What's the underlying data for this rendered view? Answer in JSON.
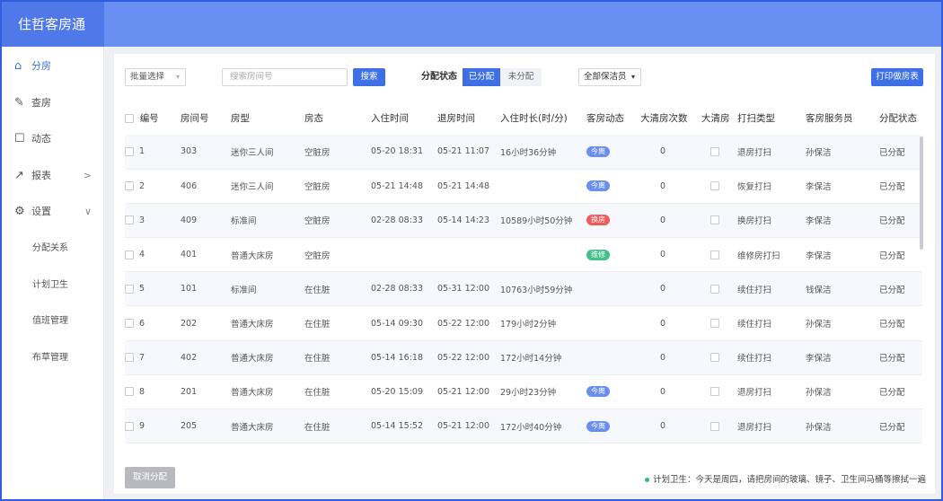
{
  "app": {
    "title": "住哲客房通",
    "header_color": "#6a8ff2",
    "accent": "#3f6fe6"
  },
  "sidebar": {
    "items": [
      {
        "label": "分房",
        "icon": "home-icon",
        "glyph": "⌂",
        "active": true
      },
      {
        "label": "查房",
        "icon": "edit-icon",
        "glyph": "✎"
      },
      {
        "label": "动态",
        "icon": "message-icon",
        "glyph": "☐"
      },
      {
        "label": "报表",
        "icon": "chart-icon",
        "glyph": "↗",
        "arrow": ">"
      },
      {
        "label": "设置",
        "icon": "settings-icon",
        "glyph": "⚙",
        "arrow": "∨"
      }
    ],
    "subitems": [
      "分配关系",
      "计划卫生",
      "值班管理",
      "布草管理"
    ]
  },
  "toolbar": {
    "batch_select": "批量选择",
    "search_placeholder": "搜索房间号",
    "search_button": "搜索",
    "status_label": "分配状态",
    "status_assigned": "已分配",
    "status_unassigned": "未分配",
    "cleaner_select": "全部保洁员",
    "print_button": "打印做房表"
  },
  "table": {
    "headers": [
      "编号",
      "房间号",
      "房型",
      "房态",
      "入住时间",
      "退房时间",
      "入住时长(时/分)",
      "客房动态",
      "大清房次数",
      "大清房",
      "打扫类型",
      "客房服务员",
      "分配状态"
    ],
    "rows": [
      {
        "no": "1",
        "room": "303",
        "type": "迷你三人间",
        "state": "空脏房",
        "in": "05-20 18:31",
        "out": "05-21 11:07",
        "dur": "16小时36分钟",
        "dyn": "今离",
        "dyn_color": "#6a8ff2",
        "count": "0",
        "clean": "退房打扫",
        "staff": "孙保洁",
        "assign": "已分配"
      },
      {
        "no": "2",
        "room": "406",
        "type": "迷你三人间",
        "state": "空脏房",
        "in": "05-21 14:48",
        "out": "05-21 14:48",
        "dur": "",
        "dyn": "今离",
        "dyn_color": "#6a8ff2",
        "count": "0",
        "clean": "恢复打扫",
        "staff": "李保洁",
        "assign": "已分配"
      },
      {
        "no": "3",
        "room": "409",
        "type": "标准间",
        "state": "空脏房",
        "in": "02-28 08:33",
        "out": "05-14 14:23",
        "dur": "10589小时50分钟",
        "dyn": "换房",
        "dyn_color": "#ef5b5b",
        "count": "0",
        "clean": "换房打扫",
        "staff": "李保洁",
        "assign": "已分配"
      },
      {
        "no": "4",
        "room": "401",
        "type": "普通大床房",
        "state": "空脏房",
        "in": "",
        "out": "",
        "dur": "",
        "dyn": "维修",
        "dyn_color": "#45c08a",
        "count": "0",
        "clean": "维修房打扫",
        "staff": "李保洁",
        "assign": "已分配"
      },
      {
        "no": "5",
        "room": "101",
        "type": "标准间",
        "state": "在住脏",
        "in": "02-28 08:33",
        "out": "05-31 12:00",
        "dur": "10763小时59分钟",
        "dyn": "",
        "dyn_color": "",
        "count": "0",
        "clean": "续住打扫",
        "staff": "钱保洁",
        "assign": "已分配"
      },
      {
        "no": "6",
        "room": "202",
        "type": "普通大床房",
        "state": "在住脏",
        "in": "05-14 09:30",
        "out": "05-22 12:00",
        "dur": "179小时2分钟",
        "dyn": "",
        "dyn_color": "",
        "count": "0",
        "clean": "续住打扫",
        "staff": "孙保洁",
        "assign": "已分配"
      },
      {
        "no": "7",
        "room": "402",
        "type": "普通大床房",
        "state": "在住脏",
        "in": "05-14 16:18",
        "out": "05-22 12:00",
        "dur": "172小时14分钟",
        "dyn": "",
        "dyn_color": "",
        "count": "0",
        "clean": "续住打扫",
        "staff": "李保洁",
        "assign": "已分配"
      },
      {
        "no": "8",
        "room": "201",
        "type": "普通大床房",
        "state": "在住脏",
        "in": "05-20 15:09",
        "out": "05-21 12:00",
        "dur": "29小时23分钟",
        "dyn": "今离",
        "dyn_color": "#6a8ff2",
        "count": "0",
        "clean": "退房打扫",
        "staff": "孙保洁",
        "assign": "已分配"
      },
      {
        "no": "9",
        "room": "205",
        "type": "普通大床房",
        "state": "在住脏",
        "in": "05-14 15:52",
        "out": "05-21 12:00",
        "dur": "172小时40分钟",
        "dyn": "今离",
        "dyn_color": "#6a8ff2",
        "count": "0",
        "clean": "退房打扫",
        "staff": "孙保洁",
        "assign": "已分配"
      }
    ]
  },
  "footer": {
    "cancel_button": "取消分配",
    "note": "计划卫生：今天是周四，请把房间的玻璃、镜子、卫生间马桶等擦拭一遍"
  }
}
